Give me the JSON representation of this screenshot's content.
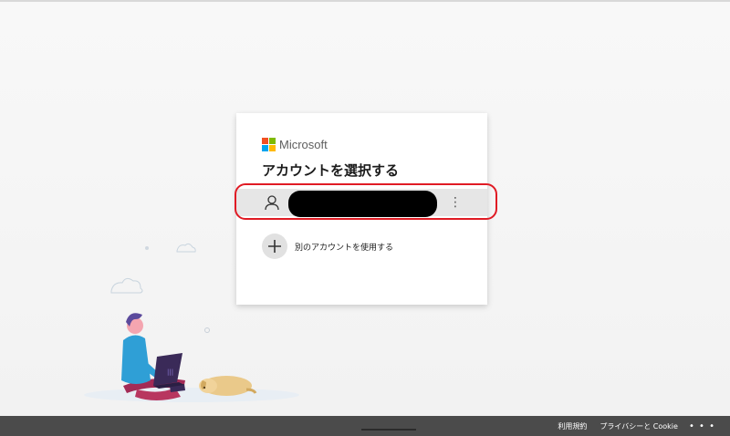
{
  "brand": {
    "name": "Microsoft",
    "logo_colors": [
      "#f25022",
      "#7fba00",
      "#00a4ef",
      "#ffb900"
    ]
  },
  "dialog": {
    "title": "アカウントを選択する"
  },
  "account": {
    "avatar_icon": "person-icon",
    "more_icon": "more-vertical-icon",
    "more_label": "⋮"
  },
  "add_account": {
    "icon": "plus-icon",
    "label": "別のアカウントを使用する"
  },
  "footer": {
    "terms": "利用規約",
    "privacy": "プライバシーと Cookie",
    "more": "• • •"
  },
  "colors": {
    "highlight": "#e01b24",
    "footer_bg": "#4b4b4b"
  }
}
